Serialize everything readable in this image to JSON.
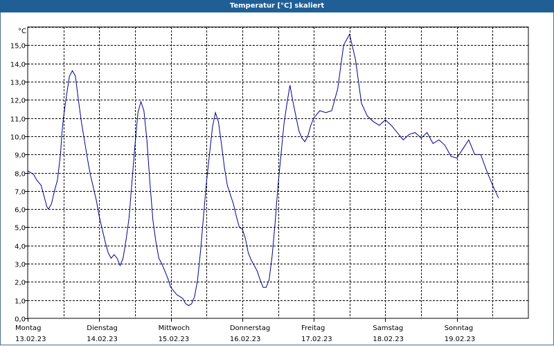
{
  "chart_data": {
    "type": "line",
    "title": "Temperatur [°C] skaliert",
    "yunit": "°C",
    "ylim": [
      0,
      16
    ],
    "yticks": [
      "0,0",
      "1,0",
      "2,0",
      "3,0",
      "4,0",
      "5,0",
      "6,0",
      "7,0",
      "8,0",
      "9,0",
      "10,0",
      "11,0",
      "12,0",
      "13,0",
      "14,0",
      "15,0"
    ],
    "xlim_hours": [
      0,
      168
    ],
    "days": [
      {
        "weekday": "Montag",
        "date": "13.02.23"
      },
      {
        "weekday": "Dienstag",
        "date": "14.02.23"
      },
      {
        "weekday": "Mittwoch",
        "date": "15.02.23"
      },
      {
        "weekday": "Donnerstag",
        "date": "16.02.23"
      },
      {
        "weekday": "Freitag",
        "date": "17.02.23"
      },
      {
        "weekday": "Samstag",
        "date": "18.02.23"
      },
      {
        "weekday": "Sonntag",
        "date": "19.02.23"
      }
    ],
    "grid": true,
    "line_color": "#00008b",
    "series": [
      {
        "hours": [
          0,
          2,
          3,
          4.5,
          6,
          6.5,
          7,
          8,
          9,
          10,
          11,
          11.5,
          12,
          13,
          14,
          15,
          16,
          17,
          18,
          19,
          20,
          21,
          22,
          23,
          24,
          26,
          27,
          28,
          29,
          30,
          31,
          32,
          33,
          34,
          35,
          36,
          37,
          38,
          39,
          40,
          41,
          42,
          43,
          44,
          45,
          46,
          47,
          48,
          50,
          51,
          52,
          53,
          54,
          55,
          56,
          57,
          58,
          59,
          60,
          61,
          62,
          63,
          64,
          65,
          66,
          67,
          68,
          69,
          70,
          71,
          72,
          73,
          74,
          75,
          76,
          77,
          78,
          79,
          80,
          81,
          82,
          83,
          84,
          86,
          87,
          88,
          89,
          90,
          91,
          92,
          93,
          94,
          95,
          96,
          98,
          100,
          102,
          104,
          106,
          108,
          110,
          112,
          114,
          116,
          118,
          120,
          122,
          124,
          126,
          128,
          130,
          132,
          134,
          136,
          138,
          140,
          142,
          144,
          146,
          148,
          150,
          152,
          154,
          156,
          158,
          160,
          162,
          164,
          166,
          168
        ],
        "values": [
          8.1,
          7.9,
          7.6,
          7.3,
          6.4,
          6.1,
          6.0,
          6.3,
          7.0,
          7.6,
          9.0,
          10.2,
          11.0,
          12.2,
          13.3,
          13.6,
          13.3,
          12.0,
          10.8,
          9.8,
          8.8,
          7.9,
          7.2,
          6.5,
          5.6,
          4.2,
          3.6,
          3.3,
          3.5,
          3.3,
          2.9,
          3.3,
          4.3,
          5.5,
          7.5,
          9.5,
          11.3,
          11.9,
          11.4,
          9.8,
          7.5,
          5.4,
          4.2,
          3.3,
          3.0,
          2.6,
          2.2,
          1.7,
          1.3,
          1.2,
          1.1,
          0.8,
          0.7,
          0.8,
          1.2,
          2.1,
          3.7,
          5.6,
          7.5,
          9.0,
          10.5,
          11.3,
          10.8,
          9.6,
          8.3,
          7.3,
          6.8,
          6.3,
          5.6,
          5.0,
          4.9,
          4.4,
          3.6,
          3.2,
          2.9,
          2.6,
          2.1,
          1.7,
          1.7,
          2.1,
          3.4,
          5.2,
          7.3,
          10.7,
          11.8,
          12.8,
          11.9,
          11.1,
          10.3,
          9.9,
          9.7,
          10.0,
          10.6,
          11.0,
          11.4,
          11.3,
          11.4,
          12.6,
          15.0,
          15.6,
          14.2,
          11.8,
          11.1,
          10.8,
          10.6,
          10.9,
          10.6,
          10.2,
          9.8,
          10.1,
          10.2,
          9.9,
          10.2,
          9.6,
          9.8,
          9.5,
          8.9,
          8.8,
          9.3,
          9.8,
          9.0,
          9.0,
          8.1,
          7.3,
          6.6
        ]
      }
    ]
  }
}
